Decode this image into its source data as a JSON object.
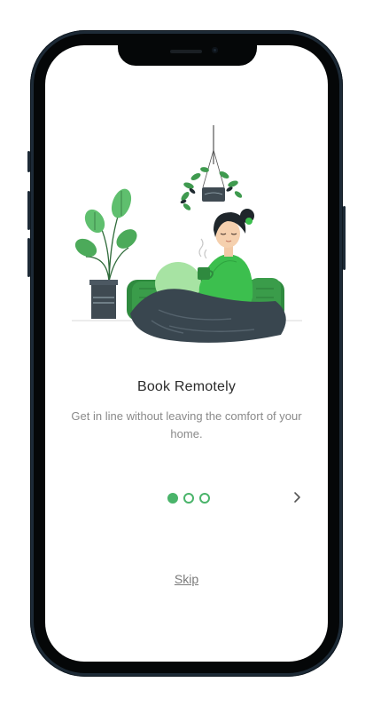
{
  "onboarding": {
    "title": "Book Remotely",
    "subtitle": "Get in line without leaving the comfort of your home.",
    "skip_label": "Skip",
    "next_icon": "chevron-right-icon",
    "page_indicator": {
      "total": 3,
      "current": 1
    }
  },
  "colors": {
    "accent": "#4ab46a",
    "title": "#2b2b2b",
    "subtitle": "#8a8a8a"
  }
}
